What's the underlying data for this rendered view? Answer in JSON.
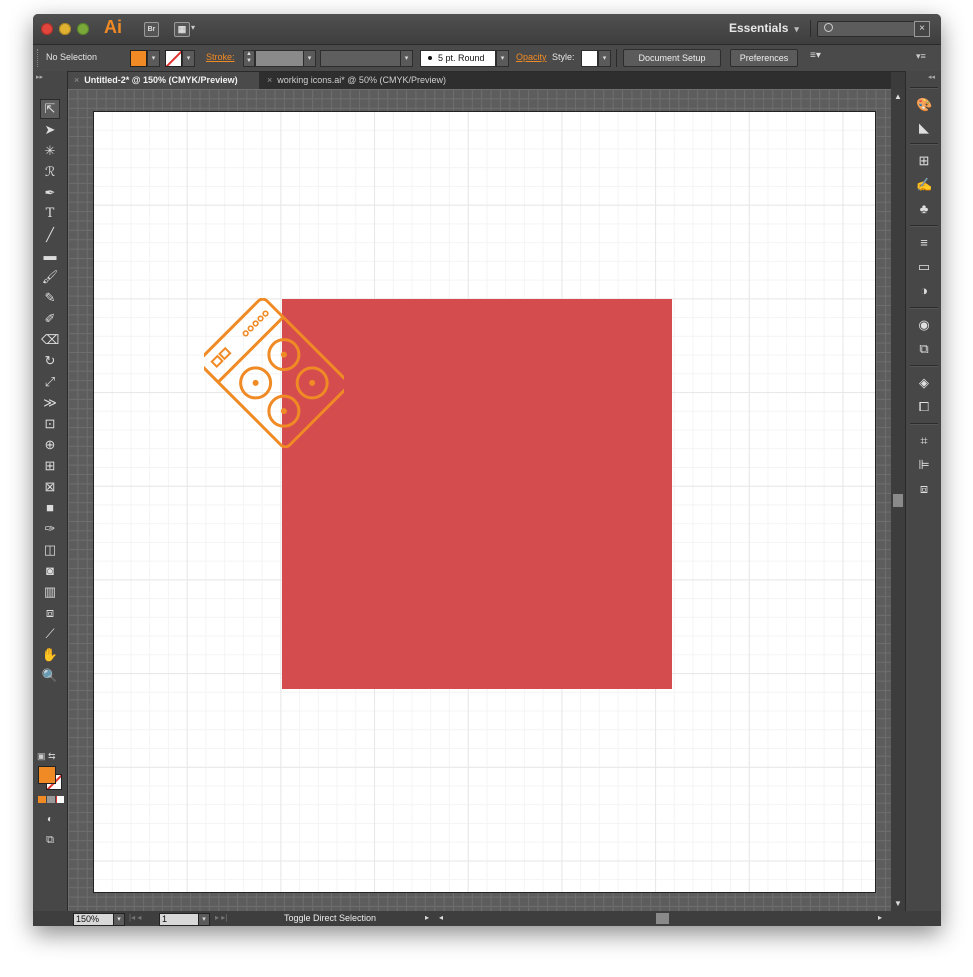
{
  "titlebar": {
    "app_logo": "Ai",
    "bridge_label": "Br",
    "workspace": "Essentials",
    "search_placeholder": ""
  },
  "controlbar": {
    "selection": "No Selection",
    "fill_color": "#f08a24",
    "stroke_label": "Stroke:",
    "brush": "5 pt. Round",
    "opacity_label": "Opacity",
    "style_label": "Style:",
    "document_setup": "Document Setup",
    "preferences": "Preferences"
  },
  "tabs": [
    {
      "label": "Untitled-2* @ 150% (CMYK/Preview)",
      "active": true
    },
    {
      "label": "working icons.ai* @ 50% (CMYK/Preview)",
      "active": false
    }
  ],
  "canvas": {
    "rect_color": "#d54c4f",
    "icon_color": "#f08a24"
  },
  "statusbar": {
    "zoom": "150%",
    "artboard": "1",
    "status": "Toggle Direct Selection"
  }
}
